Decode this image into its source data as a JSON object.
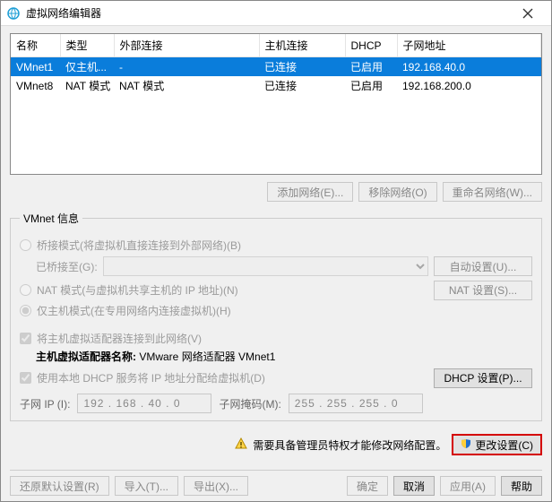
{
  "window": {
    "title": "虚拟网络编辑器"
  },
  "table": {
    "headers": {
      "name": "名称",
      "type": "类型",
      "ext": "外部连接",
      "host": "主机连接",
      "dhcp": "DHCP",
      "subnet": "子网地址"
    },
    "rows": [
      {
        "name": "VMnet1",
        "type": "仅主机...",
        "ext": "-",
        "host": "已连接",
        "dhcp": "已启用",
        "subnet": "192.168.40.0"
      },
      {
        "name": "VMnet8",
        "type": "NAT 模式",
        "ext": "NAT 模式",
        "host": "已连接",
        "dhcp": "已启用",
        "subnet": "192.168.200.0"
      }
    ]
  },
  "buttons": {
    "add_net": "添加网络(E)...",
    "remove_net": "移除网络(O)",
    "rename_net": "重命名网络(W)...",
    "auto_cfg": "自动设置(U)...",
    "nat_cfg": "NAT 设置(S)...",
    "dhcp_cfg": "DHCP 设置(P)...",
    "change": "更改设置(C)",
    "restore": "还原默认设置(R)",
    "import": "导入(T)...",
    "export": "导出(X)...",
    "ok": "确定",
    "cancel": "取消",
    "apply": "应用(A)",
    "help": "帮助"
  },
  "info": {
    "legend": "VMnet 信息",
    "bridged": "桥接模式(将虚拟机直接连接到外部网络)(B)",
    "bridged_to_label": "已桥接至(G):",
    "nat": "NAT 模式(与虚拟机共享主机的 IP 地址)(N)",
    "hostonly": "仅主机模式(在专用网络内连接虚拟机)(H)",
    "connect_host": "将主机虚拟适配器连接到此网络(V)",
    "host_adapter_label": "主机虚拟适配器名称: ",
    "host_adapter_value": "VMware 网络适配器 VMnet1",
    "use_dhcp": "使用本地 DHCP 服务将 IP 地址分配给虚拟机(D)",
    "subnet_ip_label": "子网 IP (I):",
    "subnet_ip_value": "192 . 168 . 40 . 0",
    "subnet_mask_label": "子网掩码(M):",
    "subnet_mask_value": "255 . 255 . 255 . 0"
  },
  "warn": {
    "text": "需要具备管理员特权才能修改网络配置。"
  }
}
